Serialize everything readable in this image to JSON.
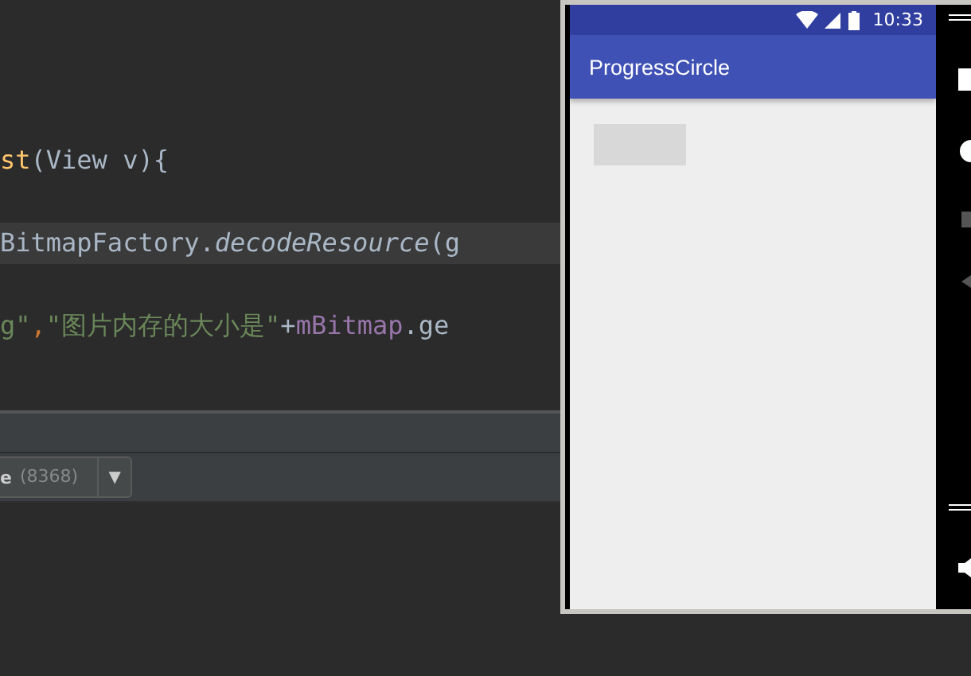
{
  "editor": {
    "lines": [
      {
        "highlighted": false,
        "tokens": [
          {
            "text": "st",
            "kind": "method"
          },
          {
            "text": "(View v){",
            "kind": "plain"
          }
        ]
      },
      {
        "highlighted": true,
        "tokens": [
          {
            "text": "BitmapFactory.",
            "kind": "plain"
          },
          {
            "text": "decodeResource",
            "kind": "static"
          },
          {
            "text": "(g",
            "kind": "plain"
          }
        ]
      },
      {
        "highlighted": false,
        "tokens": [
          {
            "text": "g\"",
            "kind": "string"
          },
          {
            "text": ",",
            "kind": "keyword"
          },
          {
            "text": "\"图片内存的大小是\"",
            "kind": "string"
          },
          {
            "text": "+",
            "kind": "plain"
          },
          {
            "text": "mBitmap",
            "kind": "field"
          },
          {
            "text": ".ge",
            "kind": "plain"
          }
        ]
      }
    ]
  },
  "run_panel": {
    "process": "e",
    "pid": "(8368)",
    "dropdown": "▼"
  },
  "emulator": {
    "status_bar": {
      "time": "10:33"
    },
    "app_bar": {
      "title": "ProgressCircle"
    }
  }
}
